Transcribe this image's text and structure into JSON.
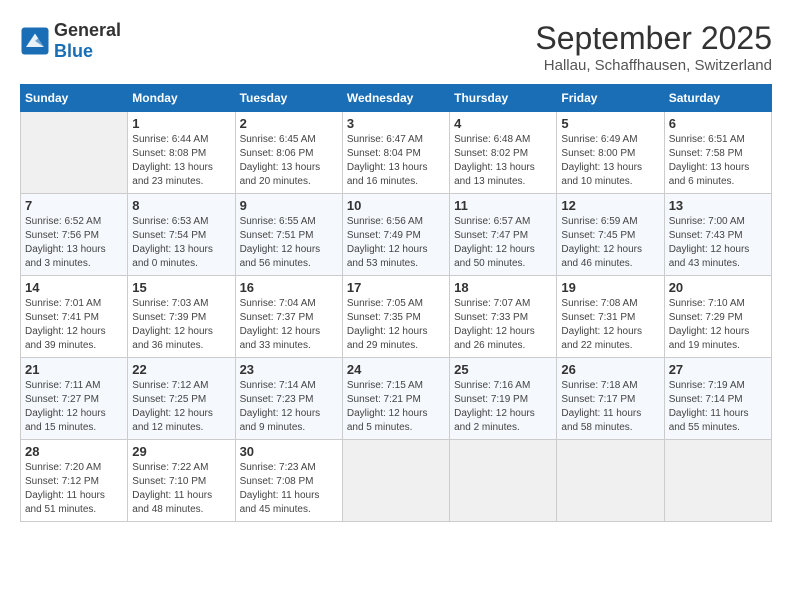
{
  "header": {
    "logo": {
      "line1": "General",
      "line2": "Blue"
    },
    "title": "September 2025",
    "subtitle": "Hallau, Schaffhausen, Switzerland"
  },
  "days_of_week": [
    "Sunday",
    "Monday",
    "Tuesday",
    "Wednesday",
    "Thursday",
    "Friday",
    "Saturday"
  ],
  "weeks": [
    [
      {
        "day": "",
        "info": ""
      },
      {
        "day": "1",
        "info": "Sunrise: 6:44 AM\nSunset: 8:08 PM\nDaylight: 13 hours\nand 23 minutes."
      },
      {
        "day": "2",
        "info": "Sunrise: 6:45 AM\nSunset: 8:06 PM\nDaylight: 13 hours\nand 20 minutes."
      },
      {
        "day": "3",
        "info": "Sunrise: 6:47 AM\nSunset: 8:04 PM\nDaylight: 13 hours\nand 16 minutes."
      },
      {
        "day": "4",
        "info": "Sunrise: 6:48 AM\nSunset: 8:02 PM\nDaylight: 13 hours\nand 13 minutes."
      },
      {
        "day": "5",
        "info": "Sunrise: 6:49 AM\nSunset: 8:00 PM\nDaylight: 13 hours\nand 10 minutes."
      },
      {
        "day": "6",
        "info": "Sunrise: 6:51 AM\nSunset: 7:58 PM\nDaylight: 13 hours\nand 6 minutes."
      }
    ],
    [
      {
        "day": "7",
        "info": "Sunrise: 6:52 AM\nSunset: 7:56 PM\nDaylight: 13 hours\nand 3 minutes."
      },
      {
        "day": "8",
        "info": "Sunrise: 6:53 AM\nSunset: 7:54 PM\nDaylight: 13 hours\nand 0 minutes."
      },
      {
        "day": "9",
        "info": "Sunrise: 6:55 AM\nSunset: 7:51 PM\nDaylight: 12 hours\nand 56 minutes."
      },
      {
        "day": "10",
        "info": "Sunrise: 6:56 AM\nSunset: 7:49 PM\nDaylight: 12 hours\nand 53 minutes."
      },
      {
        "day": "11",
        "info": "Sunrise: 6:57 AM\nSunset: 7:47 PM\nDaylight: 12 hours\nand 50 minutes."
      },
      {
        "day": "12",
        "info": "Sunrise: 6:59 AM\nSunset: 7:45 PM\nDaylight: 12 hours\nand 46 minutes."
      },
      {
        "day": "13",
        "info": "Sunrise: 7:00 AM\nSunset: 7:43 PM\nDaylight: 12 hours\nand 43 minutes."
      }
    ],
    [
      {
        "day": "14",
        "info": "Sunrise: 7:01 AM\nSunset: 7:41 PM\nDaylight: 12 hours\nand 39 minutes."
      },
      {
        "day": "15",
        "info": "Sunrise: 7:03 AM\nSunset: 7:39 PM\nDaylight: 12 hours\nand 36 minutes."
      },
      {
        "day": "16",
        "info": "Sunrise: 7:04 AM\nSunset: 7:37 PM\nDaylight: 12 hours\nand 33 minutes."
      },
      {
        "day": "17",
        "info": "Sunrise: 7:05 AM\nSunset: 7:35 PM\nDaylight: 12 hours\nand 29 minutes."
      },
      {
        "day": "18",
        "info": "Sunrise: 7:07 AM\nSunset: 7:33 PM\nDaylight: 12 hours\nand 26 minutes."
      },
      {
        "day": "19",
        "info": "Sunrise: 7:08 AM\nSunset: 7:31 PM\nDaylight: 12 hours\nand 22 minutes."
      },
      {
        "day": "20",
        "info": "Sunrise: 7:10 AM\nSunset: 7:29 PM\nDaylight: 12 hours\nand 19 minutes."
      }
    ],
    [
      {
        "day": "21",
        "info": "Sunrise: 7:11 AM\nSunset: 7:27 PM\nDaylight: 12 hours\nand 15 minutes."
      },
      {
        "day": "22",
        "info": "Sunrise: 7:12 AM\nSunset: 7:25 PM\nDaylight: 12 hours\nand 12 minutes."
      },
      {
        "day": "23",
        "info": "Sunrise: 7:14 AM\nSunset: 7:23 PM\nDaylight: 12 hours\nand 9 minutes."
      },
      {
        "day": "24",
        "info": "Sunrise: 7:15 AM\nSunset: 7:21 PM\nDaylight: 12 hours\nand 5 minutes."
      },
      {
        "day": "25",
        "info": "Sunrise: 7:16 AM\nSunset: 7:19 PM\nDaylight: 12 hours\nand 2 minutes."
      },
      {
        "day": "26",
        "info": "Sunrise: 7:18 AM\nSunset: 7:17 PM\nDaylight: 11 hours\nand 58 minutes."
      },
      {
        "day": "27",
        "info": "Sunrise: 7:19 AM\nSunset: 7:14 PM\nDaylight: 11 hours\nand 55 minutes."
      }
    ],
    [
      {
        "day": "28",
        "info": "Sunrise: 7:20 AM\nSunset: 7:12 PM\nDaylight: 11 hours\nand 51 minutes."
      },
      {
        "day": "29",
        "info": "Sunrise: 7:22 AM\nSunset: 7:10 PM\nDaylight: 11 hours\nand 48 minutes."
      },
      {
        "day": "30",
        "info": "Sunrise: 7:23 AM\nSunset: 7:08 PM\nDaylight: 11 hours\nand 45 minutes."
      },
      {
        "day": "",
        "info": ""
      },
      {
        "day": "",
        "info": ""
      },
      {
        "day": "",
        "info": ""
      },
      {
        "day": "",
        "info": ""
      }
    ]
  ]
}
